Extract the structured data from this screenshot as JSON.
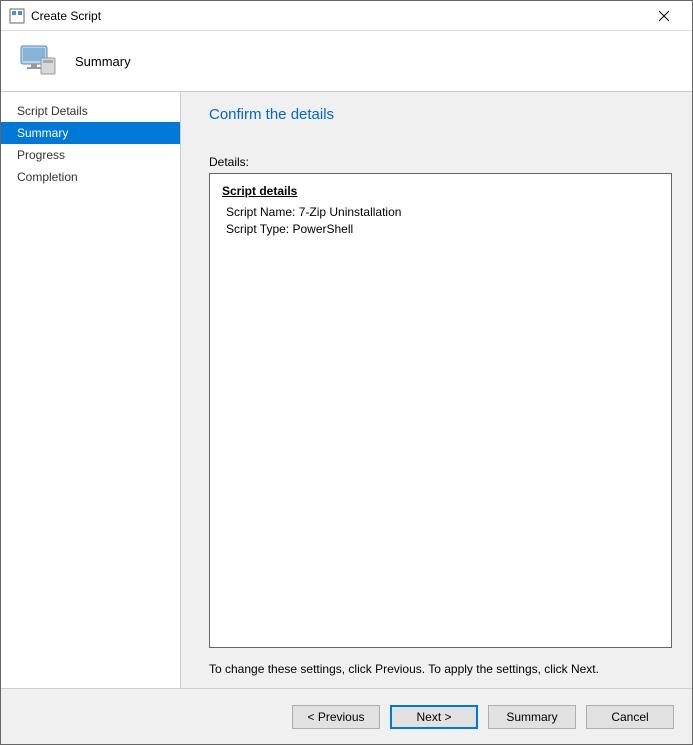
{
  "window": {
    "title": "Create Script"
  },
  "header": {
    "title": "Summary"
  },
  "sidebar": {
    "items": [
      {
        "label": "Script Details",
        "selected": false
      },
      {
        "label": "Summary",
        "selected": true
      },
      {
        "label": "Progress",
        "selected": false
      },
      {
        "label": "Completion",
        "selected": false
      }
    ]
  },
  "main": {
    "heading": "Confirm the details",
    "details_label": "Details:",
    "section_title": "Script details",
    "script_name_label": "Script Name:",
    "script_name_value": "7-Zip Uninstallation",
    "script_type_label": "Script Type:",
    "script_type_value": "PowerShell",
    "hint": "To change these settings, click Previous. To apply the settings, click Next."
  },
  "footer": {
    "previous": "< Previous",
    "next": "Next >",
    "summary": "Summary",
    "cancel": "Cancel"
  }
}
